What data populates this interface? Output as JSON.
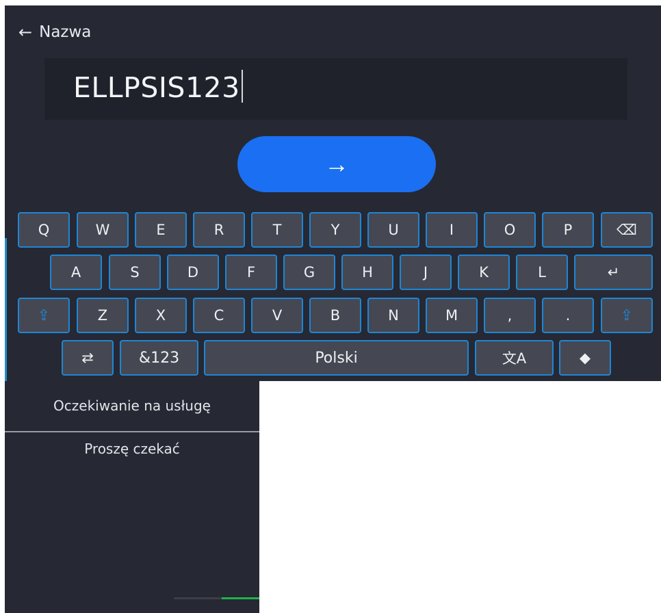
{
  "header": {
    "back_icon": "←",
    "title": "Nazwa"
  },
  "input": {
    "value": "ELLPSIS123"
  },
  "go_button": {
    "icon": "→"
  },
  "keyboard": {
    "row1": [
      "Q",
      "W",
      "E",
      "R",
      "T",
      "Y",
      "U",
      "I",
      "O",
      "P"
    ],
    "backspace_icon": "⌫",
    "row2": [
      "A",
      "S",
      "D",
      "F",
      "G",
      "H",
      "J",
      "K",
      "L"
    ],
    "enter_icon": "↵",
    "shift_icon": "⇪",
    "row3": [
      "Z",
      "X",
      "C",
      "V",
      "B",
      "N",
      "M",
      ",",
      "."
    ],
    "switch_icon": "⇄",
    "symbols_label": "&123",
    "space_label": "Polski",
    "translate_icon": "文A",
    "eraser_icon": "◆"
  },
  "status": {
    "title": "Oczekiwanie na usługę",
    "message": "Proszę czekać",
    "progress": 0.44
  },
  "colors": {
    "panel_background": "#262833",
    "key_border": "#1e86d6",
    "key_fill": "#454852",
    "accent_button": "#1a6ff2",
    "progress_fill": "#1fb34a"
  }
}
